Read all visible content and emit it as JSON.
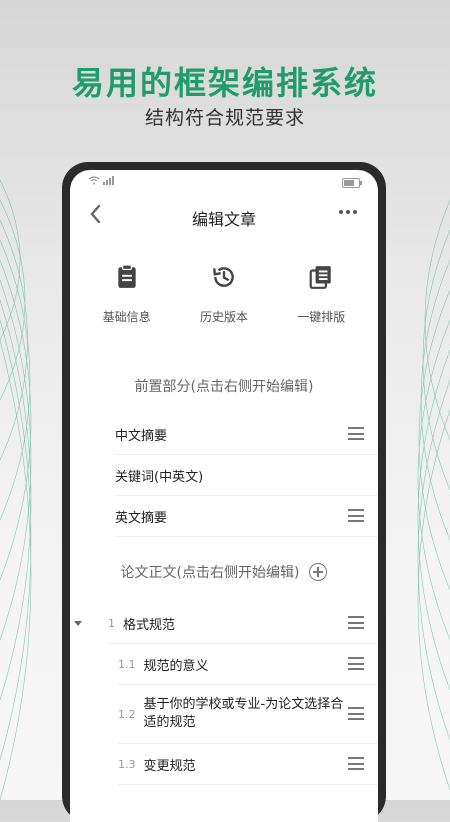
{
  "hero": {
    "title": "易用的框架编排系统",
    "subtitle": "结构符合规范要求"
  },
  "colors": {
    "brand": "#1f9b6e"
  },
  "nav": {
    "back_icon": "chevron-left-icon",
    "title": "编辑文章",
    "more_icon": "more-dots-icon"
  },
  "actions": [
    {
      "icon": "clipboard-icon",
      "label": "基础信息"
    },
    {
      "icon": "history-icon",
      "label": "历史版本"
    },
    {
      "icon": "layers-icon",
      "label": "一键排版"
    }
  ],
  "front_section": {
    "hint": "前置部分(点击右侧开始编辑)",
    "items": [
      "中文摘要",
      "关键词(中英文)",
      "英文摘要"
    ]
  },
  "body_section": {
    "hint": "论文正文(点击右侧开始编辑)"
  },
  "outline": [
    {
      "num": "1",
      "title": "格式规范"
    },
    {
      "num": "1.1",
      "title": "规范的意义"
    },
    {
      "num": "1.2",
      "title": "基于你的学校或专业-为论文选择合适的规范"
    },
    {
      "num": "1.3",
      "title": "变更规范"
    }
  ]
}
